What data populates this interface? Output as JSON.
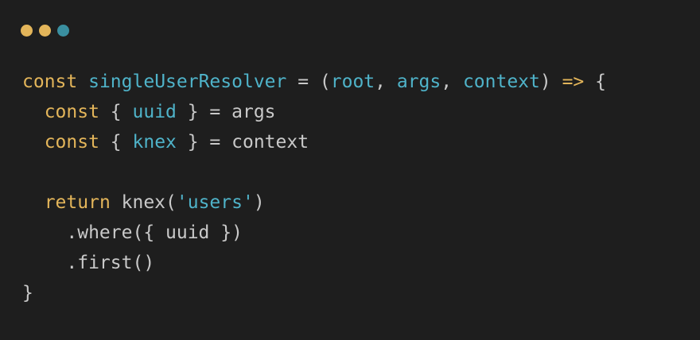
{
  "window": {
    "controls": [
      {
        "name": "close",
        "color": "#e3b55a"
      },
      {
        "name": "minimize",
        "color": "#e3b55a"
      },
      {
        "name": "zoom",
        "color": "#3a8fa0"
      }
    ]
  },
  "colors": {
    "background": "#1e1e1e",
    "keyword": "#e3b55a",
    "identifier": "#4fb3c9",
    "plain": "#c9c9c9",
    "punctuation": "#c9c9c9"
  },
  "code": {
    "language": "javascript",
    "lines": [
      [
        {
          "text": "const",
          "kind": "keyword"
        },
        {
          "text": " ",
          "kind": "plain"
        },
        {
          "text": "singleUserResolver",
          "kind": "identifier"
        },
        {
          "text": " = (",
          "kind": "plain"
        },
        {
          "text": "root",
          "kind": "identifier"
        },
        {
          "text": ", ",
          "kind": "plain"
        },
        {
          "text": "args",
          "kind": "identifier"
        },
        {
          "text": ", ",
          "kind": "plain"
        },
        {
          "text": "context",
          "kind": "identifier"
        },
        {
          "text": ") ",
          "kind": "plain"
        },
        {
          "text": "=>",
          "kind": "keyword"
        },
        {
          "text": " {",
          "kind": "plain"
        }
      ],
      [
        {
          "text": "  ",
          "kind": "plain"
        },
        {
          "text": "const",
          "kind": "keyword"
        },
        {
          "text": " { ",
          "kind": "plain"
        },
        {
          "text": "uuid",
          "kind": "identifier"
        },
        {
          "text": " } = args",
          "kind": "plain"
        }
      ],
      [
        {
          "text": "  ",
          "kind": "plain"
        },
        {
          "text": "const",
          "kind": "keyword"
        },
        {
          "text": " { ",
          "kind": "plain"
        },
        {
          "text": "knex",
          "kind": "identifier"
        },
        {
          "text": " } = context",
          "kind": "plain"
        }
      ],
      [
        {
          "text": "",
          "kind": "plain"
        }
      ],
      [
        {
          "text": "  ",
          "kind": "plain"
        },
        {
          "text": "return",
          "kind": "keyword"
        },
        {
          "text": " knex(",
          "kind": "plain"
        },
        {
          "text": "'users'",
          "kind": "identifier"
        },
        {
          "text": ")",
          "kind": "plain"
        }
      ],
      [
        {
          "text": "    .where({ uuid })",
          "kind": "plain"
        }
      ],
      [
        {
          "text": "    .first()",
          "kind": "plain"
        }
      ],
      [
        {
          "text": "}",
          "kind": "plain"
        }
      ]
    ]
  }
}
